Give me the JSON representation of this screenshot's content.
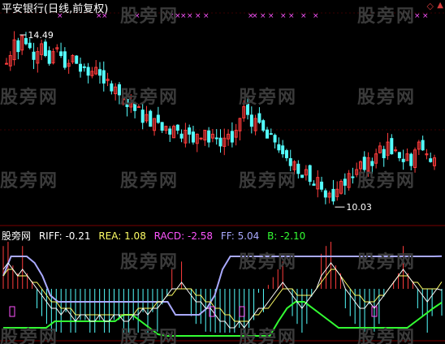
{
  "header": {
    "title": "平安银行(日线,前复权)"
  },
  "indicator": {
    "panel_label": "股旁网",
    "riff": "RIFF: -0.21",
    "rea": "REA: 1.08",
    "racd": "RACD: -2.58",
    "ff": "FF: 5.04",
    "b": "B: -2.10"
  },
  "annotations": {
    "high": "14.49",
    "low": "10.03"
  },
  "watermark": "股旁网",
  "colors": {
    "background": "#000000",
    "up_candle": "#ff3c3c",
    "down_candle": "#54ffff",
    "riff": "#ffffff",
    "rea": "#ffff66",
    "racd": "#ff55ff",
    "ff": "#aaaaff",
    "b": "#33ff33",
    "grid": "#7a0000"
  },
  "chart_data": {
    "type": "candlestick",
    "title": "平安银行(日线,前复权)",
    "price_high": 14.49,
    "price_low": 10.03,
    "ylim": [
      9.6,
      14.8
    ],
    "close": [
      13.6,
      13.8,
      14.2,
      13.9,
      14.3,
      14.1,
      14.0,
      13.7,
      13.9,
      14.1,
      13.8,
      13.6,
      13.9,
      14.0,
      13.8,
      13.5,
      13.6,
      13.8,
      13.6,
      13.4,
      13.5,
      13.3,
      13.4,
      13.5,
      13.3,
      13.1,
      13.2,
      12.9,
      13.0,
      12.8,
      12.7,
      12.5,
      12.6,
      12.4,
      12.5,
      12.1,
      12.3,
      12.0,
      12.2,
      12.1,
      11.9,
      12.0,
      11.8,
      12.0,
      11.9,
      11.7,
      11.9,
      11.8,
      11.6,
      11.8,
      11.7,
      11.9,
      11.6,
      11.8,
      11.7,
      11.5,
      11.7,
      11.8,
      11.6,
      11.9,
      12.2,
      12.5,
      12.3,
      12.0,
      12.2,
      12.1,
      11.9,
      11.7,
      11.8,
      11.6,
      11.4,
      11.3,
      11.2,
      11.0,
      11.1,
      10.8,
      10.7,
      10.9,
      10.6,
      10.5,
      10.7,
      10.4,
      10.2,
      10.3,
      10.1,
      10.4,
      10.6,
      10.5,
      10.8,
      10.7,
      10.9,
      11.1,
      10.9,
      11.2,
      11.0,
      11.3,
      11.5,
      11.2,
      11.6,
      11.3,
      11.4,
      11.2,
      11.1,
      11.3,
      11.0,
      11.4,
      11.6,
      11.4,
      11.3,
      11.1,
      11.2
    ],
    "ind_riff": [
      3,
      4,
      3,
      2,
      3,
      2,
      1,
      0,
      -1,
      -2,
      -3,
      -3,
      -4,
      -3,
      -4,
      -5,
      -4,
      -4,
      -5,
      -5,
      -4,
      -5,
      -5,
      -4,
      -4,
      -5,
      -5,
      -4,
      -4,
      -3,
      -4,
      -3,
      -3,
      -2,
      -1,
      0,
      0,
      1,
      0,
      -1,
      -2,
      -2,
      -3,
      -3,
      -4,
      -5,
      -5,
      -6,
      -6,
      -5,
      -6,
      -5,
      -4,
      -3,
      -3,
      -2,
      -1,
      0,
      1,
      0,
      -1,
      -2,
      -3,
      -2,
      -1,
      0,
      2,
      3,
      4,
      3,
      2,
      0,
      -1,
      -2,
      -3,
      -3,
      -2,
      -3,
      -2,
      -1,
      0,
      1,
      2,
      3,
      2,
      1,
      0,
      -1,
      -2,
      -1,
      0,
      -0.21
    ],
    "ind_rea": [
      2,
      3,
      3,
      2,
      2,
      2,
      1,
      1,
      0,
      -1,
      -2,
      -2,
      -3,
      -3,
      -3,
      -4,
      -4,
      -4,
      -4,
      -4,
      -4,
      -4,
      -4,
      -4,
      -4,
      -4,
      -4,
      -4,
      -3,
      -3,
      -3,
      -3,
      -2,
      -2,
      -1,
      -1,
      0,
      0,
      0,
      0,
      -1,
      -1,
      -2,
      -2,
      -3,
      -3,
      -4,
      -4,
      -5,
      -5,
      -5,
      -5,
      -4,
      -4,
      -3,
      -3,
      -2,
      -1,
      0,
      0,
      0,
      -1,
      -1,
      -1,
      -1,
      0,
      1,
      2,
      3,
      3,
      2,
      1,
      0,
      -1,
      -1,
      -2,
      -2,
      -2,
      -1,
      -1,
      0,
      1,
      2,
      2,
      2,
      1,
      1,
      0,
      0,
      0,
      0,
      1.08
    ],
    "ind_ff": [
      2,
      5,
      5,
      5,
      4,
      2,
      -1,
      -2,
      -2,
      -2,
      -2,
      -2,
      -2,
      -2,
      -2,
      -2,
      -2,
      -2,
      -2,
      -2,
      -2,
      -2,
      -4,
      -4,
      -4,
      -4,
      -3,
      -1,
      3,
      5,
      5,
      5,
      5,
      5,
      5,
      5,
      5,
      5,
      5,
      5,
      5,
      5,
      5,
      5,
      5,
      5,
      5,
      5,
      5,
      5,
      5,
      5,
      5,
      5,
      5,
      5,
      5.04
    ],
    "ind_b": [
      -6,
      -6,
      -6,
      -6,
      -6,
      -6,
      -5,
      -5,
      -5,
      -5,
      -5,
      -5,
      -5,
      -5,
      -4,
      -4,
      -5,
      -6,
      -7,
      -8,
      -9,
      -9,
      -9,
      -9,
      -9,
      -9,
      -9,
      -9,
      -9,
      -9,
      -9,
      -8,
      -5,
      -3,
      -2,
      -2,
      -3,
      -4,
      -5,
      -6,
      -6,
      -6,
      -6,
      -6,
      -6,
      -6,
      -6,
      -6,
      -5,
      -4,
      -3,
      -2.1
    ]
  }
}
